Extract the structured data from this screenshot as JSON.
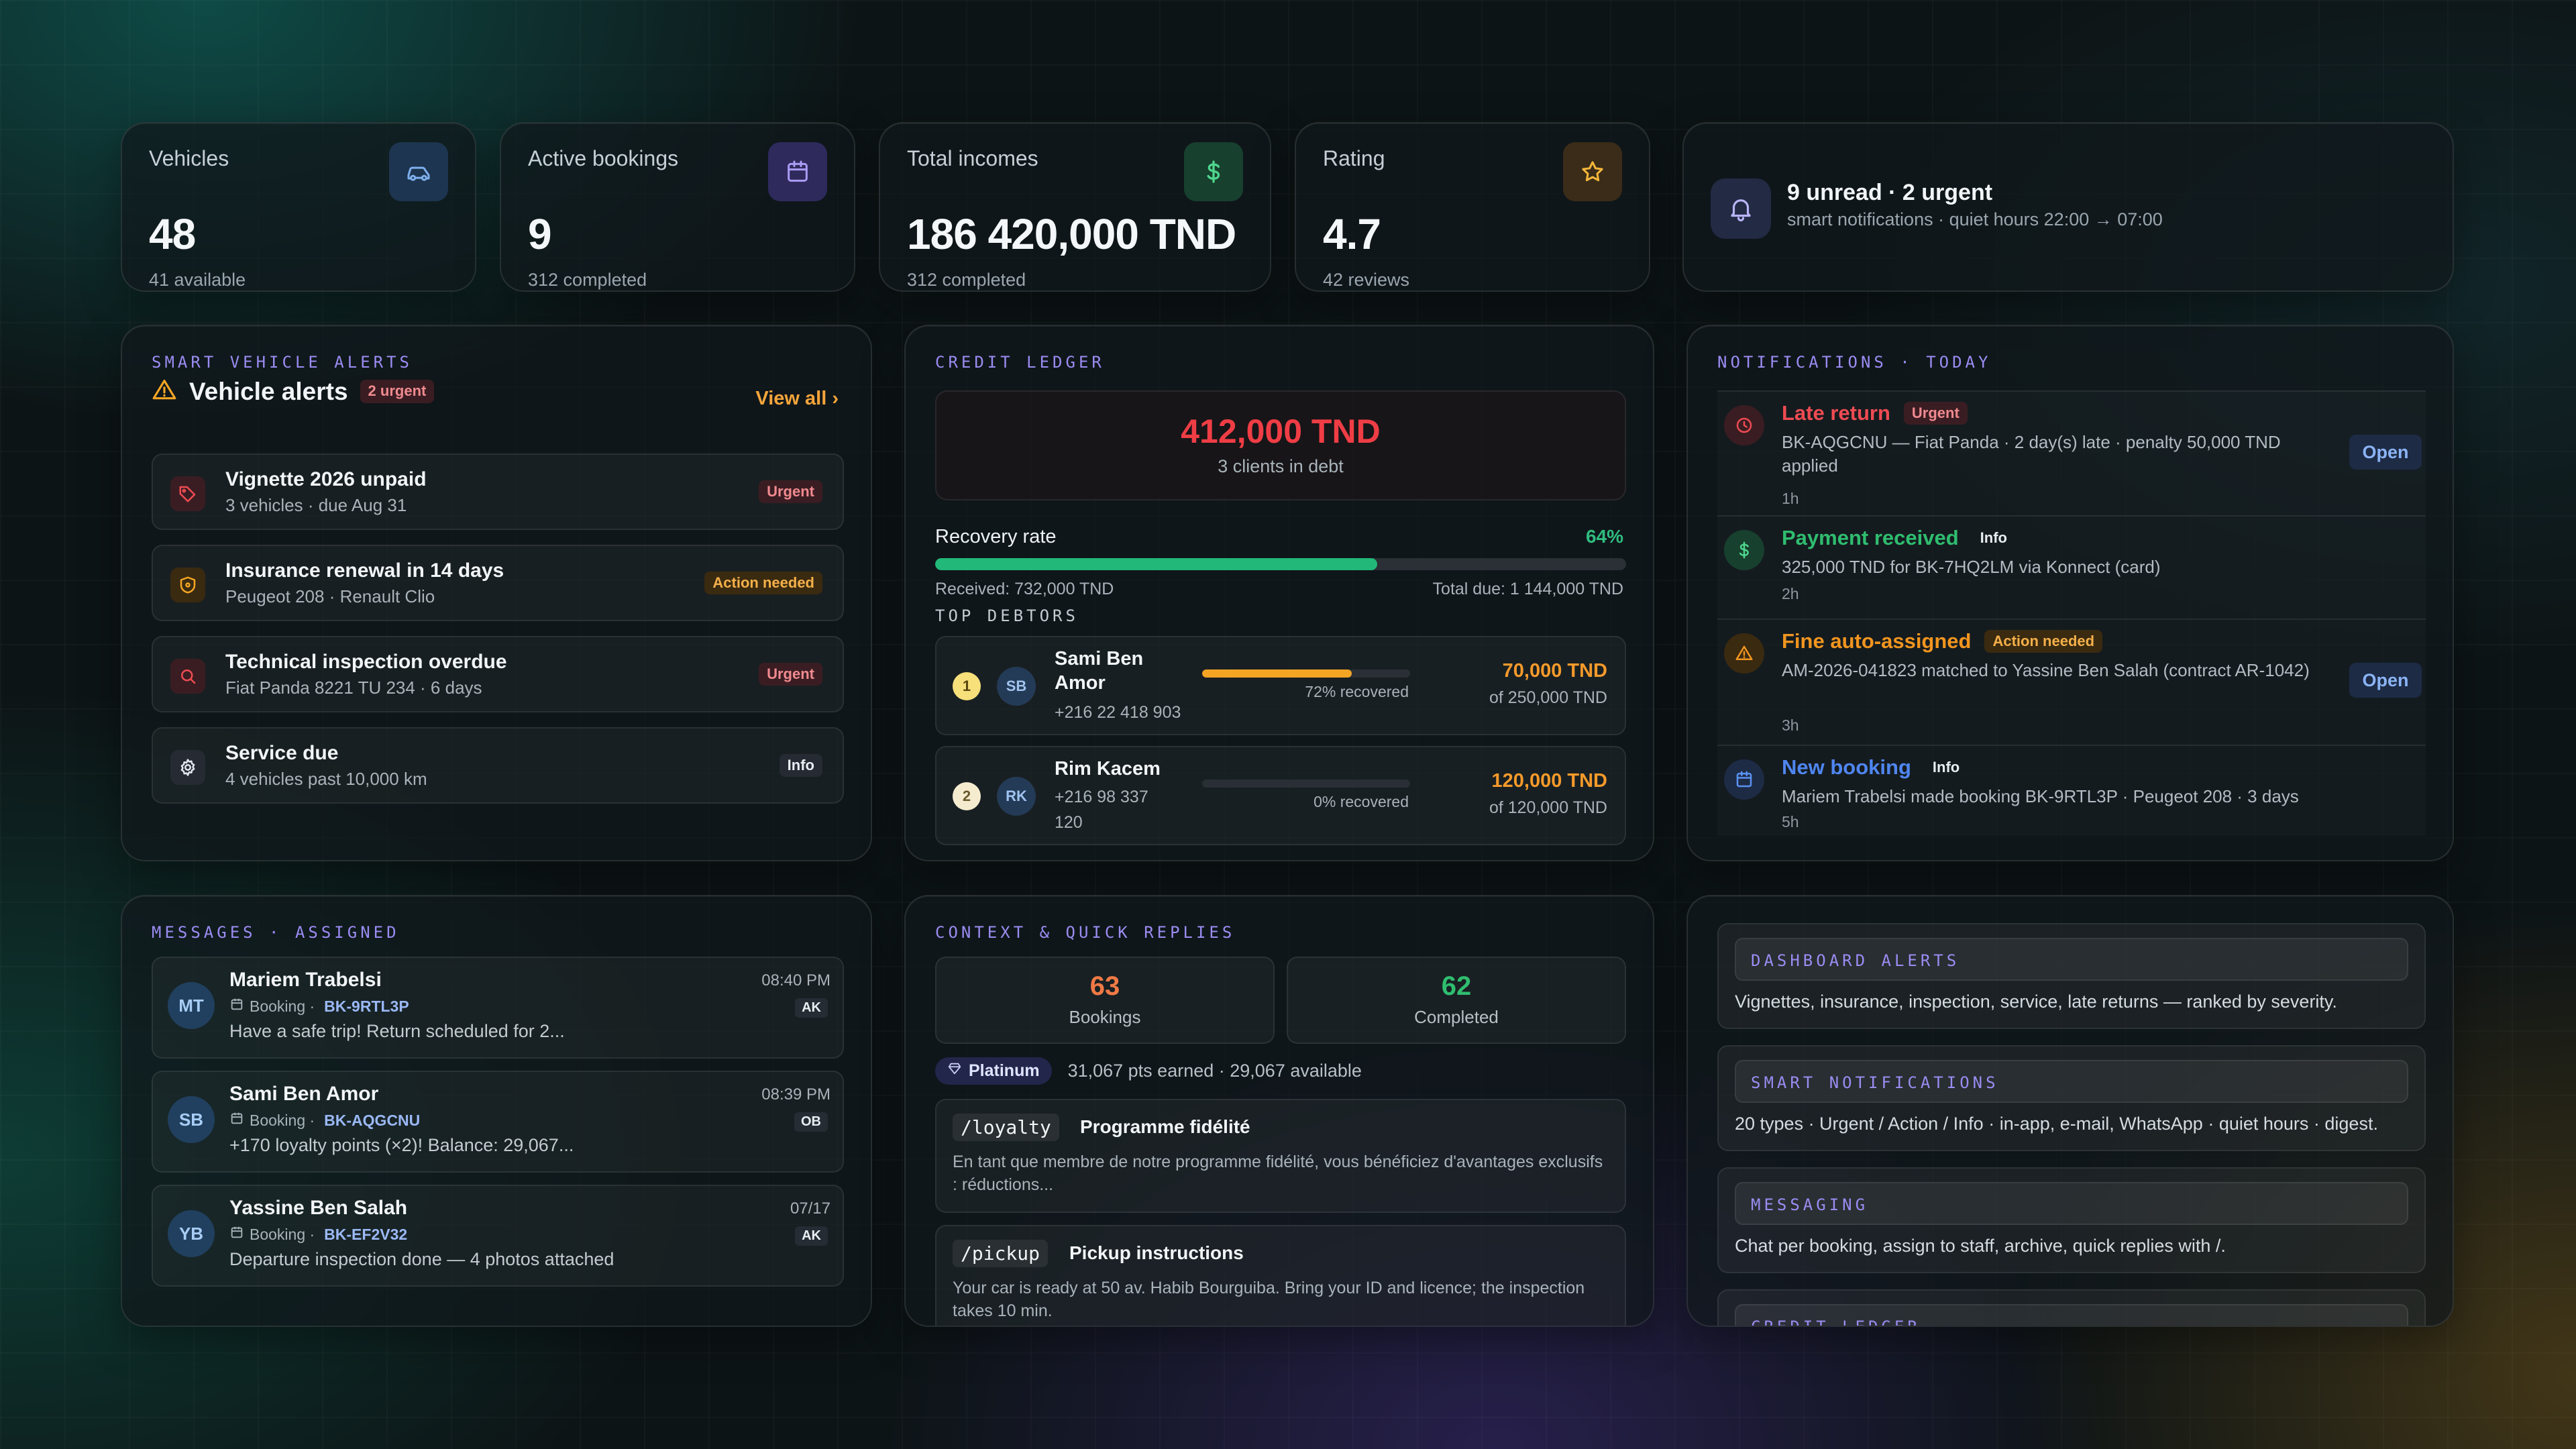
{
  "kpis": [
    {
      "label": "Vehicles",
      "value": "48",
      "sub": "41 available",
      "icon": "car-icon"
    },
    {
      "label": "Active bookings",
      "value": "9",
      "sub": "312 completed",
      "icon": "calendar-icon"
    },
    {
      "label": "Total incomes",
      "value": "186 420,000 TND",
      "sub": "312 completed",
      "icon": "dollar-icon"
    },
    {
      "label": "Rating",
      "value": "4.7",
      "sub": "42 reviews",
      "icon": "star-icon"
    }
  ],
  "notif_summary": {
    "title": "9 unread · 2 urgent",
    "subtitle": "smart notifications · quiet hours 22:00 → 07:00"
  },
  "vehicle_alerts": {
    "section": "SMART VEHICLE ALERTS",
    "title": "Vehicle alerts",
    "badge": "2 urgent",
    "view_all": "View all",
    "items": [
      {
        "title": "Vignette 2026 unpaid",
        "sub": "3 vehicles · due Aug 31",
        "badge": "Urgent",
        "icon": "tag-icon"
      },
      {
        "title": "Insurance renewal in 14 days",
        "sub": "Peugeot 208 · Renault Clio",
        "badge": "Action needed",
        "icon": "shield-icon"
      },
      {
        "title": "Technical inspection overdue",
        "sub": "Fiat Panda 8221 TU 234 · 6 days",
        "badge": "Urgent",
        "icon": "search-icon"
      },
      {
        "title": "Service due",
        "sub": "4 vehicles past 10,000 km",
        "badge": "Info",
        "icon": "gear-icon"
      }
    ]
  },
  "credit": {
    "section": "CREDIT LEDGER",
    "debt": "412,000 TND",
    "debt_sub": "3 clients in debt",
    "recovery_label": "Recovery rate",
    "recovery_pct": "64%",
    "recovery_value": 0.64,
    "received": "Received: 732,000 TND",
    "total_due": "Total due: 1 144,000 TND",
    "top_debtors_label": "TOP DEBTORS",
    "debtors": [
      {
        "rank": "1",
        "initials": "SB",
        "name": "Sami Ben Amor",
        "phone": "+216 22 418 903",
        "recovered": "72% recovered",
        "recovered_value": 0.72,
        "amount": "70,000 TND",
        "of": "of 250,000 TND"
      },
      {
        "rank": "2",
        "initials": "RK",
        "name": "Rim Kacem",
        "phone": "+216 98 337 120",
        "recovered": "0% recovered",
        "recovered_value": 0,
        "amount": "120,000 TND",
        "of": "of 120,000 TND"
      }
    ]
  },
  "notifications": {
    "section": "NOTIFICATIONS · TODAY",
    "items": [
      {
        "title": "Late return",
        "badge": "Urgent",
        "body": "BK-AQGCNU — Fiat Panda · 2 day(s) late · penalty 50,000 TND applied",
        "time": "1h",
        "action": "Open",
        "icon": "clock-icon",
        "color": "#ef4b52"
      },
      {
        "title": "Payment received",
        "badge": "Info",
        "body": "325,000 TND for BK-7HQ2LM via Konnect (card)",
        "time": "2h",
        "action": "",
        "icon": "dollar-icon",
        "color": "#2fbd6f"
      },
      {
        "title": "Fine auto-assigned",
        "badge": "Action needed",
        "body": "AM-2026-041823 matched to Yassine Ben Salah (contract AR-1042)",
        "time": "3h",
        "action": "Open",
        "icon": "warning-icon",
        "color": "#f2951f"
      },
      {
        "title": "New booking",
        "badge": "Info",
        "body": "Mariem Trabelsi made booking BK-9RTL3P · Peugeot 208 · 3 days",
        "time": "5h",
        "action": "",
        "icon": "calendar-icon",
        "color": "#4f86f0"
      }
    ]
  },
  "messages": {
    "section": "MESSAGES · ASSIGNED",
    "items": [
      {
        "initials": "MT",
        "name": "Mariem Trabelsi",
        "time": "08:40 PM",
        "booking_label": "Booking ·",
        "booking": "BK-9RTL3P",
        "tag": "AK",
        "text": "Have a safe trip! Return scheduled for 2..."
      },
      {
        "initials": "SB",
        "name": "Sami Ben Amor",
        "time": "08:39 PM",
        "booking_label": "Booking ·",
        "booking": "BK-AQGCNU",
        "tag": "OB",
        "text": "+170 loyalty points (×2)! Balance: 29,067..."
      },
      {
        "initials": "YB",
        "name": "Yassine Ben Salah",
        "time": "07/17",
        "booking_label": "Booking ·",
        "booking": "BK-EF2V32",
        "tag": "AK",
        "text": "Departure inspection done — 4 photos attached"
      }
    ]
  },
  "context": {
    "section": "CONTEXT & QUICK REPLIES",
    "bookings_value": "63",
    "bookings_label": "Bookings",
    "completed_value": "62",
    "completed_label": "Completed",
    "tier": "Platinum",
    "points": "31,067 pts earned · 29,067 available",
    "replies": [
      {
        "cmd": "/loyalty",
        "title": "Programme fidélité",
        "body": "En tant que membre de notre programme fidélité, vous bénéficiez d'avantages exclusifs : réductions..."
      },
      {
        "cmd": "/pickup",
        "title": "Pickup instructions",
        "body": "Your car is ready at 50 av. Habib Bourguiba. Bring your ID and licence; the inspection takes 10 min."
      }
    ]
  },
  "features": [
    {
      "title": "DASHBOARD ALERTS",
      "body": "Vignettes, insurance, inspection, service, late returns — ranked by severity."
    },
    {
      "title": "SMART NOTIFICATIONS",
      "body": "20 types · Urgent / Action / Info · in-app, e-mail, WhatsApp · quiet hours · digest."
    },
    {
      "title": "MESSAGING",
      "body": "Chat per booking, assign to staff, archive, quick replies with /."
    },
    {
      "title": "CREDIT LEDGER",
      "body": ""
    }
  ],
  "colors": {
    "urgent": "#ef4b52",
    "action": "#f5a524",
    "success": "#22b87a",
    "accent": "#9b8cf2",
    "info": "#4f86f0"
  }
}
